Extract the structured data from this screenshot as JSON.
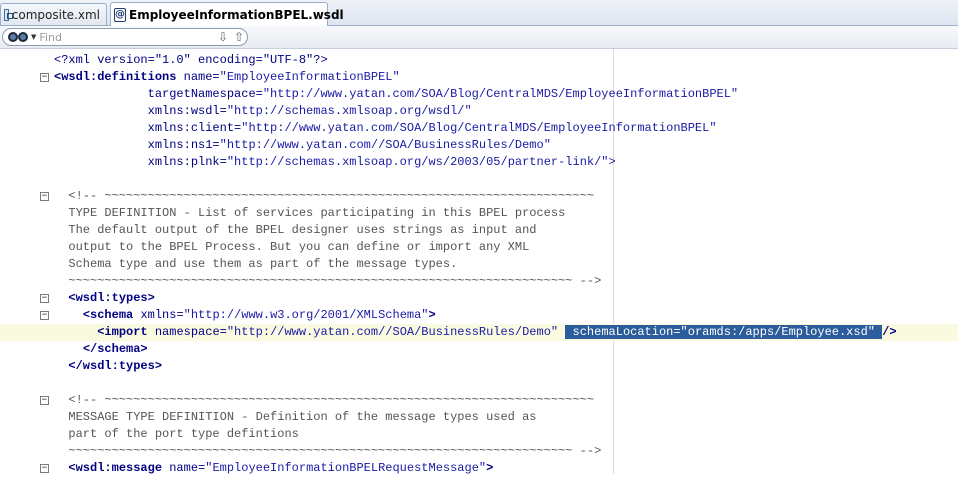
{
  "tabs": [
    {
      "label": "composite.xml",
      "icon": "composite-diagram-icon",
      "active": false
    },
    {
      "label": "EmployeeInformationBPEL.wsdl",
      "icon": "wsdl-file-icon",
      "active": true
    }
  ],
  "find": {
    "placeholder": "Find",
    "icon": "binoculars-icon",
    "next_icon": "find-next-arrow-icon",
    "prev_icon": "find-previous-arrow-icon"
  },
  "editor": {
    "lines": [
      {
        "fold": false,
        "segments": [
          [
            "pi",
            "<?xml version=\"1.0\" encoding=\"UTF-8\"?>"
          ]
        ]
      },
      {
        "fold": true,
        "segments": [
          [
            "t",
            "<wsdl:definitions"
          ],
          [
            "p",
            " "
          ],
          [
            "a",
            "name="
          ],
          [
            "v",
            "\"EmployeeInformationBPEL\""
          ]
        ]
      },
      {
        "fold": false,
        "segments": [
          [
            "p",
            "             "
          ],
          [
            "a",
            "targetNamespace="
          ],
          [
            "v",
            "\"http://www.yatan.com/SOA/Blog/CentralMDS/EmployeeInformationBPEL\""
          ]
        ]
      },
      {
        "fold": false,
        "segments": [
          [
            "p",
            "             "
          ],
          [
            "a",
            "xmlns:wsdl="
          ],
          [
            "v",
            "\"http://schemas.xmlsoap.org/wsdl/\""
          ]
        ]
      },
      {
        "fold": false,
        "segments": [
          [
            "p",
            "             "
          ],
          [
            "a",
            "xmlns:client="
          ],
          [
            "v",
            "\"http://www.yatan.com/SOA/Blog/CentralMDS/EmployeeInformationBPEL\""
          ]
        ]
      },
      {
        "fold": false,
        "segments": [
          [
            "p",
            "             "
          ],
          [
            "a",
            "xmlns:ns1="
          ],
          [
            "v",
            "\"http://www.yatan.com//SOA/BusinessRules/Demo\""
          ]
        ]
      },
      {
        "fold": false,
        "segments": [
          [
            "p",
            "             "
          ],
          [
            "a",
            "xmlns:plnk="
          ],
          [
            "v",
            "\"http://schemas.xmlsoap.org/ws/2003/05/partner-link/\">"
          ]
        ]
      },
      {
        "fold": false,
        "segments": []
      },
      {
        "fold": true,
        "segments": [
          [
            "cm",
            "  <!-- ~~~~~~~~~~~~~~~~~~~~~~~~~~~~~~~~~~~~~~~~~~~~~~~~~~~~~~~~~~~~~~~~~~~~"
          ]
        ]
      },
      {
        "fold": false,
        "segments": [
          [
            "cm",
            "  TYPE DEFINITION - List of services participating in this BPEL process"
          ]
        ]
      },
      {
        "fold": false,
        "segments": [
          [
            "cm",
            "  The default output of the BPEL designer uses strings as input and"
          ]
        ]
      },
      {
        "fold": false,
        "segments": [
          [
            "cm",
            "  output to the BPEL Process. But you can define or import any XML"
          ]
        ]
      },
      {
        "fold": false,
        "segments": [
          [
            "cm",
            "  Schema type and use them as part of the message types."
          ]
        ]
      },
      {
        "fold": false,
        "segments": [
          [
            "cm",
            "  ~~~~~~~~~~~~~~~~~~~~~~~~~~~~~~~~~~~~~~~~~~~~~~~~~~~~~~~~~~~~~~~~~~~~~~ -->"
          ]
        ]
      },
      {
        "fold": true,
        "segments": [
          [
            "p",
            "  "
          ],
          [
            "t",
            "<wsdl:types>"
          ]
        ]
      },
      {
        "fold": true,
        "segments": [
          [
            "p",
            "    "
          ],
          [
            "t",
            "<schema"
          ],
          [
            "p",
            " "
          ],
          [
            "a",
            "xmlns="
          ],
          [
            "v",
            "\"http://www.w3.org/2001/XMLSchema\""
          ],
          [
            "t",
            ">"
          ]
        ]
      },
      {
        "fold": false,
        "current": true,
        "segments": [
          [
            "p",
            "      "
          ],
          [
            "t",
            "<import"
          ],
          [
            "p",
            " "
          ],
          [
            "a",
            "namespace="
          ],
          [
            "v",
            "\"http://www.yatan.com//SOA/BusinessRules/Demo\""
          ],
          [
            "p",
            " "
          ],
          [
            "sel",
            " schemaLocation=\"oramds:/apps/Employee.xsd\" "
          ],
          [
            "t",
            "/>"
          ]
        ]
      },
      {
        "fold": false,
        "segments": [
          [
            "p",
            "    "
          ],
          [
            "t",
            "</schema>"
          ]
        ]
      },
      {
        "fold": false,
        "segments": [
          [
            "p",
            "  "
          ],
          [
            "t",
            "</wsdl:types>"
          ]
        ]
      },
      {
        "fold": false,
        "segments": []
      },
      {
        "fold": true,
        "segments": [
          [
            "cm",
            "  <!-- ~~~~~~~~~~~~~~~~~~~~~~~~~~~~~~~~~~~~~~~~~~~~~~~~~~~~~~~~~~~~~~~~~~~~"
          ]
        ]
      },
      {
        "fold": false,
        "segments": [
          [
            "cm",
            "  MESSAGE TYPE DEFINITION - Definition of the message types used as"
          ]
        ]
      },
      {
        "fold": false,
        "segments": [
          [
            "cm",
            "  part of the port type defintions"
          ]
        ]
      },
      {
        "fold": false,
        "segments": [
          [
            "cm",
            "  ~~~~~~~~~~~~~~~~~~~~~~~~~~~~~~~~~~~~~~~~~~~~~~~~~~~~~~~~~~~~~~~~~~~~~~ -->"
          ]
        ]
      },
      {
        "fold": true,
        "segments": [
          [
            "p",
            "  "
          ],
          [
            "t",
            "<wsdl:message"
          ],
          [
            "p",
            " "
          ],
          [
            "a",
            "name="
          ],
          [
            "v",
            "\"EmployeeInformationBPELRequestMessage\""
          ],
          [
            "t",
            ">"
          ]
        ]
      }
    ]
  }
}
